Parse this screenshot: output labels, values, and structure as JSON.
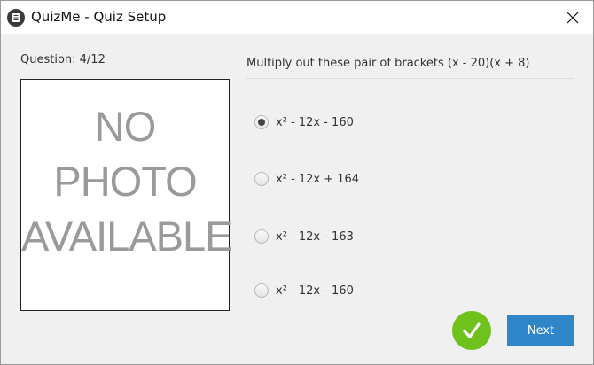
{
  "window": {
    "title": "QuizMe - Quiz Setup"
  },
  "quiz": {
    "question_counter": "Question: 4/12",
    "photo_placeholder": [
      "NO",
      "PHOTO",
      "AVAILABLE"
    ],
    "question_text": "Multiply out these pair of brackets (x - 20)(x + 8)",
    "options": [
      {
        "label": "x² - 12x - 160",
        "selected": true
      },
      {
        "label": "x² - 12x + 164",
        "selected": false
      },
      {
        "label": "x² - 12x - 163",
        "selected": false
      },
      {
        "label": "x² - 12x - 160",
        "selected": false
      }
    ]
  },
  "actions": {
    "next_label": "Next"
  },
  "colors": {
    "accent_blue": "#2f86c8",
    "check_green": "#6fc21c"
  }
}
